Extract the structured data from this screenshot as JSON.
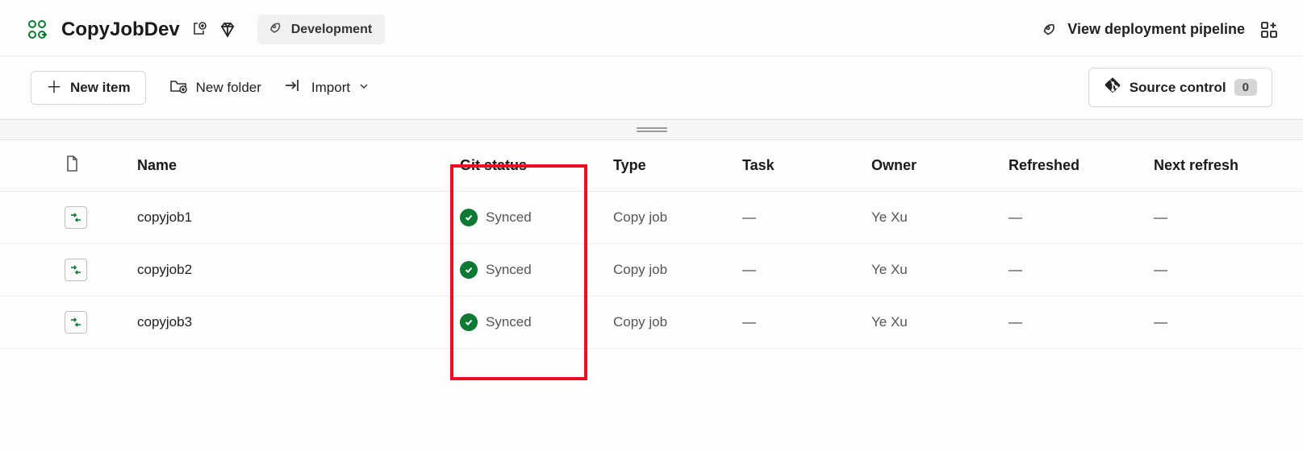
{
  "header": {
    "title": "CopyJobDev",
    "stage": "Development",
    "pipeline_label": "View deployment pipeline"
  },
  "toolbar": {
    "new_item": "New item",
    "new_folder": "New folder",
    "import": "Import",
    "source_control": "Source control",
    "source_control_count": "0"
  },
  "table": {
    "headers": {
      "name": "Name",
      "git_status": "Git status",
      "type": "Type",
      "task": "Task",
      "owner": "Owner",
      "refreshed": "Refreshed",
      "next_refresh": "Next refresh"
    },
    "dash": "—",
    "rows": [
      {
        "name": "copyjob1",
        "git_status": "Synced",
        "type": "Copy job",
        "task": "—",
        "owner": "Ye Xu",
        "refreshed": "—",
        "next_refresh": "—"
      },
      {
        "name": "copyjob2",
        "git_status": "Synced",
        "type": "Copy job",
        "task": "—",
        "owner": "Ye Xu",
        "refreshed": "—",
        "next_refresh": "—"
      },
      {
        "name": "copyjob3",
        "git_status": "Synced",
        "type": "Copy job",
        "task": "—",
        "owner": "Ye Xu",
        "refreshed": "—",
        "next_refresh": "—"
      }
    ]
  },
  "colors": {
    "accent_green": "#0d7a33",
    "highlight_red": "#e81123"
  }
}
